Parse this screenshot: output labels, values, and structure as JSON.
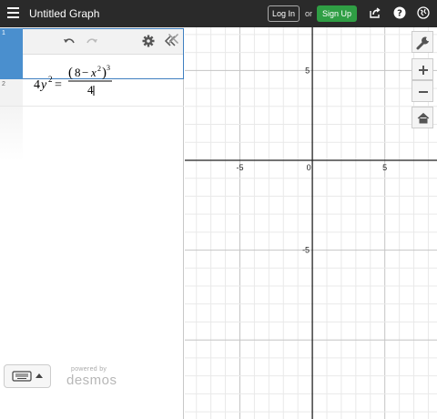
{
  "header": {
    "title": "Untitled Graph",
    "login_label": "Log In",
    "or_label": "or",
    "signup_label": "Sign Up"
  },
  "expression_list": {
    "items": [
      {
        "index": "1",
        "latex_text": "4y^2 = (8 - x^2)^3 / 4"
      },
      {
        "index": "2",
        "latex_text": ""
      }
    ]
  },
  "formula": {
    "lhs_coef": "4",
    "lhs_var": "y",
    "lhs_exp": "2",
    "eq": "=",
    "num_open": "(",
    "num_const": "8",
    "num_minus": "−",
    "num_var": "x",
    "num_inner_exp": "2",
    "num_close": ")",
    "num_outer_exp": "3",
    "den": "4"
  },
  "footer": {
    "powered_by": "powered by",
    "brand": "desmos"
  },
  "graph": {
    "x_range": [
      -8.8,
      8.6
    ],
    "y_range": [
      -14.4,
      7.4
    ],
    "x_tick_labels": [
      "-5",
      "0",
      "5"
    ],
    "y_tick_labels": [
      "5",
      "-5"
    ]
  },
  "colors": {
    "topbar": "#2a2a2a",
    "signup": "#2f9e44",
    "expr_accent": "#4a8fce"
  }
}
